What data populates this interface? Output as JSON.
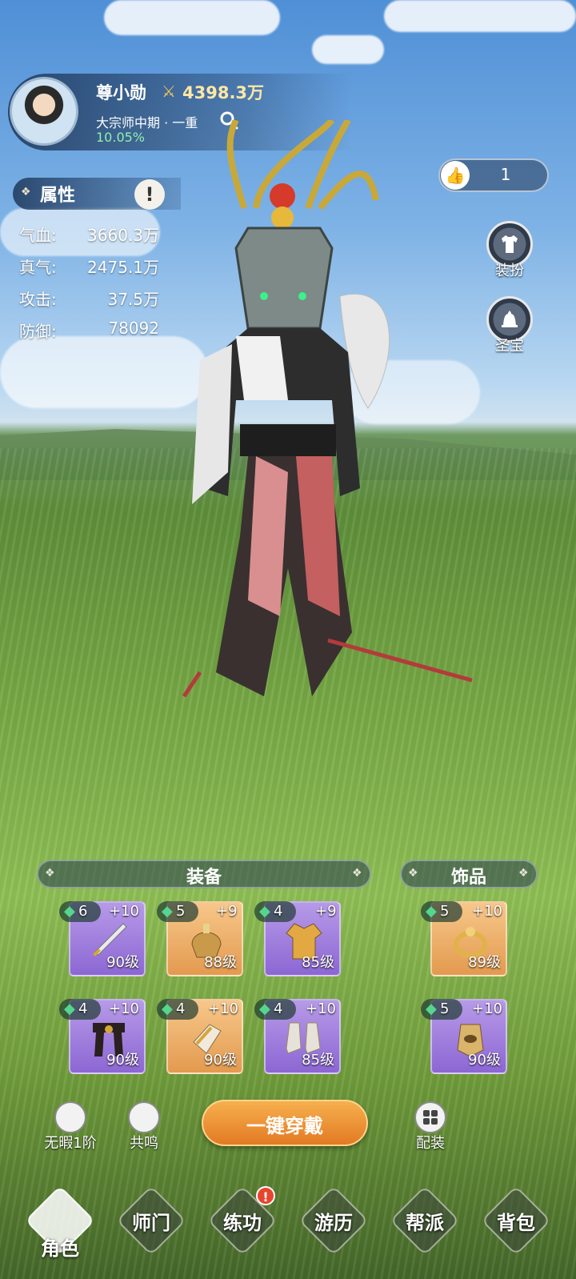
{
  "player": {
    "name": "尊小勋",
    "power": "4398.3万",
    "realm": "大宗师中期 · 一重",
    "progress": "10.05%"
  },
  "likes": {
    "count": "1",
    "icon": "thumbs-up-icon"
  },
  "attributes": {
    "title": "属性",
    "rows": [
      {
        "label": "气血:",
        "value": "3660.3万"
      },
      {
        "label": "真气:",
        "value": "2475.1万"
      },
      {
        "label": "攻击:",
        "value": "37.5万"
      },
      {
        "label": "防御:",
        "value": "78092"
      }
    ]
  },
  "side_buttons": [
    {
      "label": "装扮",
      "icon": "outfit-icon"
    },
    {
      "label": "圣宝",
      "icon": "bell-icon"
    }
  ],
  "equipment": {
    "title": "装备",
    "slots": [
      {
        "gem": "6",
        "plus": "+10",
        "level": "90级",
        "rarity": "purple"
      },
      {
        "gem": "5",
        "plus": "+9",
        "level": "88级",
        "rarity": "orange"
      },
      {
        "gem": "4",
        "plus": "+9",
        "level": "85级",
        "rarity": "purple"
      },
      {
        "gem": "4",
        "plus": "+10",
        "level": "90级",
        "rarity": "purple"
      },
      {
        "gem": "4",
        "plus": "+10",
        "level": "90级",
        "rarity": "orange"
      },
      {
        "gem": "4",
        "plus": "+10",
        "level": "85级",
        "rarity": "purple"
      }
    ]
  },
  "accessories": {
    "title": "饰品",
    "slots": [
      {
        "gem": "5",
        "plus": "+10",
        "level": "89级",
        "rarity": "orange"
      },
      {
        "gem": "5",
        "plus": "+10",
        "level": "90级",
        "rarity": "purple"
      }
    ]
  },
  "actions": {
    "flawless": "无暇1阶",
    "resonance": "共鸣",
    "equip_all": "一键穿戴",
    "loadout": "配装"
  },
  "nav": [
    {
      "label": "角色",
      "active": true
    },
    {
      "label": "师门"
    },
    {
      "label": "练功",
      "badge": "!"
    },
    {
      "label": "游历"
    },
    {
      "label": "帮派"
    },
    {
      "label": "背包"
    }
  ],
  "colors": {
    "accent_orange": "#e37a24",
    "gem_green": "#56d58e",
    "purple_slot": "#8c67d3",
    "orange_slot": "#e39a4f"
  }
}
